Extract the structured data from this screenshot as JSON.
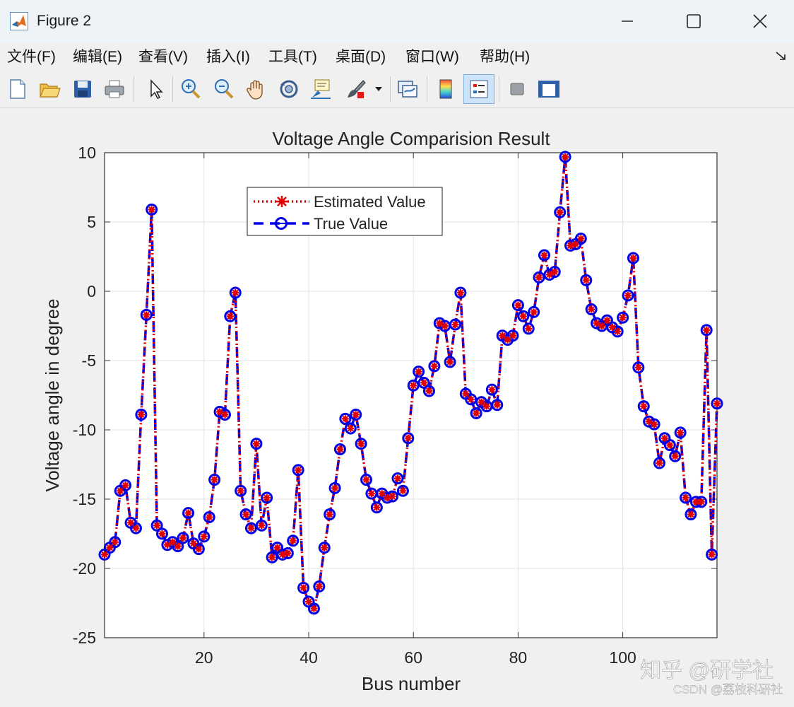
{
  "window": {
    "title": "Figure 2"
  },
  "menu": [
    "文件(F)",
    "编辑(E)",
    "查看(V)",
    "插入(I)",
    "工具(T)",
    "桌面(D)",
    "窗口(W)",
    "帮助(H)"
  ],
  "toolbar": [
    "new-figure",
    "open-file",
    "save",
    "print",
    "select-arrow",
    "zoom-in",
    "zoom-out",
    "pan",
    "rotate-3d",
    "data-cursor",
    "brush",
    "link-plot",
    "colorbar",
    "legend",
    "hide-plot-tools",
    "show-plot-tools"
  ],
  "chart_data": {
    "type": "line",
    "title": "Voltage Angle Comparision Result",
    "xlabel": "Bus number",
    "ylabel": "Voltage angle in degree",
    "xlim": [
      1,
      118
    ],
    "ylim": [
      -25,
      10
    ],
    "xticks": [
      "20",
      "40",
      "60",
      "80",
      "100"
    ],
    "yticks": [
      "10",
      "5",
      "0",
      "-5",
      "-10",
      "-15",
      "-20",
      "-25"
    ],
    "grid": true,
    "legend_position": "upper-left inside",
    "x": [
      1,
      2,
      3,
      4,
      5,
      6,
      7,
      8,
      9,
      10,
      11,
      12,
      13,
      14,
      15,
      16,
      17,
      18,
      19,
      20,
      21,
      22,
      23,
      24,
      25,
      26,
      27,
      28,
      29,
      30,
      31,
      32,
      33,
      34,
      35,
      36,
      37,
      38,
      39,
      40,
      41,
      42,
      43,
      44,
      45,
      46,
      47,
      48,
      49,
      50,
      51,
      52,
      53,
      54,
      55,
      56,
      57,
      58,
      59,
      60,
      61,
      62,
      63,
      64,
      65,
      66,
      67,
      68,
      69,
      70,
      71,
      72,
      73,
      74,
      75,
      76,
      77,
      78,
      79,
      80,
      81,
      82,
      83,
      84,
      85,
      86,
      87,
      88,
      89,
      90,
      91,
      92,
      93,
      94,
      95,
      96,
      97,
      98,
      99,
      100,
      101,
      102,
      103,
      104,
      105,
      106,
      107,
      108,
      109,
      110,
      111,
      112,
      113,
      114,
      115,
      116,
      117,
      118
    ],
    "series": [
      {
        "name": "Estimated Value",
        "color": "#e00000",
        "style": "dotted",
        "marker": "asterisk",
        "values": [
          -19.0,
          -18.5,
          -18.1,
          -14.4,
          -14.0,
          -16.7,
          -17.1,
          -8.9,
          -1.7,
          5.9,
          -16.9,
          -17.5,
          -18.3,
          -18.1,
          -18.4,
          -17.8,
          -16.0,
          -18.2,
          -18.6,
          -17.7,
          -16.3,
          -13.6,
          -8.7,
          -8.9,
          -1.8,
          -0.1,
          -14.4,
          -16.1,
          -17.1,
          -11.0,
          -16.9,
          -14.9,
          -19.2,
          -18.5,
          -19.0,
          -18.9,
          -18.0,
          -12.9,
          -21.4,
          -22.4,
          -22.9,
          -21.3,
          -18.5,
          -16.1,
          -14.2,
          -11.4,
          -9.2,
          -9.9,
          -8.9,
          -11.0,
          -13.6,
          -14.6,
          -15.6,
          -14.6,
          -14.9,
          -14.8,
          -13.5,
          -14.4,
          -10.6,
          -6.8,
          -5.8,
          -6.6,
          -7.2,
          -5.4,
          -2.3,
          -2.5,
          -5.1,
          -2.4,
          -0.1,
          -7.4,
          -7.8,
          -8.8,
          -8.0,
          -8.3,
          -7.1,
          -8.2,
          -3.2,
          -3.5,
          -3.2,
          -1.0,
          -1.8,
          -2.7,
          -1.5,
          1.0,
          2.6,
          1.2,
          1.4,
          5.7,
          9.7,
          3.3,
          3.4,
          3.8,
          0.8,
          -1.3,
          -2.3,
          -2.5,
          -2.1,
          -2.6,
          -2.9,
          -1.9,
          -0.3,
          2.4,
          -5.5,
          -8.3,
          -9.4,
          -9.6,
          -12.4,
          -10.6,
          -11.1,
          -11.9,
          -10.2,
          -14.9,
          -16.1,
          -15.2,
          -15.2,
          -2.8,
          -19.0,
          -8.1
        ]
      },
      {
        "name": "True Value",
        "color": "#0000e6",
        "style": "dashed",
        "marker": "circle",
        "values": [
          -19.0,
          -18.5,
          -18.1,
          -14.4,
          -14.0,
          -16.7,
          -17.1,
          -8.9,
          -1.7,
          5.9,
          -16.9,
          -17.5,
          -18.3,
          -18.1,
          -18.4,
          -17.8,
          -16.0,
          -18.2,
          -18.6,
          -17.7,
          -16.3,
          -13.6,
          -8.7,
          -8.9,
          -1.8,
          -0.1,
          -14.4,
          -16.1,
          -17.1,
          -11.0,
          -16.9,
          -14.9,
          -19.2,
          -18.5,
          -19.0,
          -18.9,
          -18.0,
          -12.9,
          -21.4,
          -22.4,
          -22.9,
          -21.3,
          -18.5,
          -16.1,
          -14.2,
          -11.4,
          -9.2,
          -9.9,
          -8.9,
          -11.0,
          -13.6,
          -14.6,
          -15.6,
          -14.6,
          -14.9,
          -14.8,
          -13.5,
          -14.4,
          -10.6,
          -6.8,
          -5.8,
          -6.6,
          -7.2,
          -5.4,
          -2.3,
          -2.5,
          -5.1,
          -2.4,
          -0.1,
          -7.4,
          -7.8,
          -8.8,
          -8.0,
          -8.3,
          -7.1,
          -8.2,
          -3.2,
          -3.5,
          -3.2,
          -1.0,
          -1.8,
          -2.7,
          -1.5,
          1.0,
          2.6,
          1.2,
          1.4,
          5.7,
          9.7,
          3.3,
          3.4,
          3.8,
          0.8,
          -1.3,
          -2.3,
          -2.5,
          -2.1,
          -2.6,
          -2.9,
          -1.9,
          -0.3,
          2.4,
          -5.5,
          -8.3,
          -9.4,
          -9.6,
          -12.4,
          -10.6,
          -11.1,
          -11.9,
          -10.2,
          -14.9,
          -16.1,
          -15.2,
          -15.2,
          -2.8,
          -19.0,
          -8.1
        ]
      }
    ]
  },
  "watermark": {
    "line1": "知乎 @研学社",
    "line2": "CSDN @荔枝科研社"
  }
}
